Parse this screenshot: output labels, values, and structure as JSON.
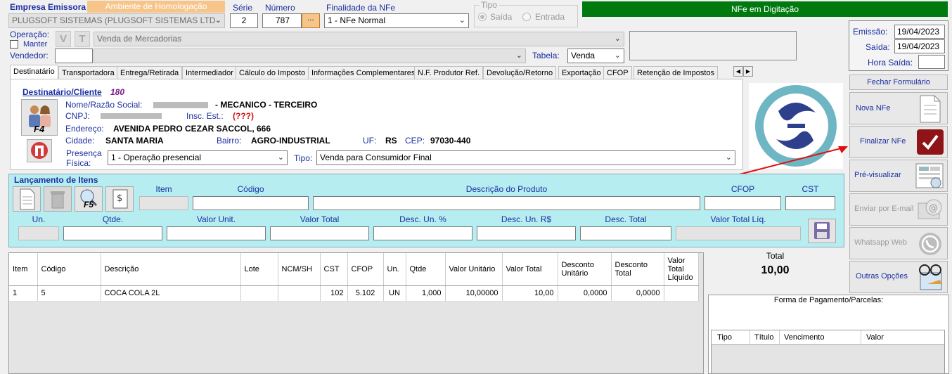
{
  "header": {
    "empresa_label": "Empresa Emissora",
    "empresa_value": "PLUGSOFT SISTEMAS  (PLUGSOFT SISTEMAS LTD",
    "ambiente": "Ambiente de Homologação",
    "serie_label": "Série",
    "serie_value": "2",
    "numero_label": "Número",
    "numero_value": "787",
    "numero_btn": "...",
    "finalidade_label": "Finalidade da NFe",
    "finalidade_value": "1 - NFe Normal",
    "tipo_label": "Tipo",
    "tipo_saida": "Saída",
    "tipo_entrada": "Entrada",
    "status": "NFe em Digitação",
    "operacao_label": "Operação:",
    "manter_label": "Manter",
    "v_btn": "V",
    "t_btn": "T",
    "operacao_value": "Venda de Mercadorias",
    "vendedor_label": "Vendedor:",
    "vendedor_code": "",
    "vendedor_value": "",
    "tabela_label": "Tabela:",
    "tabela_value": "Venda"
  },
  "dates": {
    "emissao_label": "Emissão:",
    "emissao_value": "19/04/2023",
    "saida_label": "Saída:",
    "saida_value": "19/04/2023",
    "hora_label": "Hora Saída:",
    "hora_value": ""
  },
  "tabs": [
    "Destinatário",
    "Transportadora",
    "Entrega/Retirada",
    "Intermediador",
    "Cálculo do Imposto",
    "Informações Complementares",
    "N.F. Produtor Ref.",
    "Devolução/Retorno",
    "Exportação",
    "CFOP",
    "Retenção de Impostos"
  ],
  "dest": {
    "title": "Destinatário/Cliente",
    "code": "180",
    "nome_label": "Nome/Razão Social:",
    "nome_value": "- MECANICO - TERCEIRO",
    "cnpj_label": "CNPJ:",
    "ie_label": "Insc. Est.:",
    "ie_value": "(???)",
    "endereco_label": "Endereço:",
    "endereco_value": "AVENIDA PEDRO CEZAR SACCOL, 666",
    "cidade_label": "Cidade:",
    "cidade_value": "SANTA MARIA",
    "bairro_label": "Bairro:",
    "bairro_value": "AGRO-INDUSTRIAL",
    "uf_label": "UF:",
    "uf_value": "RS",
    "cep_label": "CEP:",
    "cep_value": "97030-440",
    "presenca_label1": "Presença",
    "presenca_label2": "Física:",
    "presenca_value": "1 - Operação presencial",
    "tipo_label": "Tipo:",
    "tipo_value": "Venda para Consumidor Final",
    "f4": "F4"
  },
  "lancamento": {
    "title": "Lançamento de Itens",
    "f5": "F5",
    "item": "Item",
    "codigo": "Código",
    "descricao": "Descrição do Produto",
    "cfop": "CFOP",
    "cst": "CST",
    "un": "Un.",
    "qtde": "Qtde.",
    "valor_unit": "Valor Unit.",
    "valor_total": "Valor Total",
    "desc_un_pct": "Desc. Un. %",
    "desc_un_rs": "Desc. Un. R$",
    "desc_total": "Desc. Total",
    "valor_total_liq": "Valor Total Líq."
  },
  "sidebar": {
    "fechar": "Fechar Formulário",
    "nova": "Nova NFe",
    "finalizar": "Finalizar NFe",
    "previsualizar": "Pré-visualizar",
    "email": "Enviar por E-mail",
    "whatsapp": "Whatsapp Web",
    "outras": "Outras Opções"
  },
  "grid": {
    "headers": [
      "Item",
      "Código",
      "Descrição",
      "Lote",
      "NCM/SH",
      "CST",
      "CFOP",
      "Un.",
      "Qtde",
      "Valor Unitário",
      "Valor Total",
      "Desconto Unitário",
      "Desconto Total",
      "Valor Total Líquido"
    ],
    "rows": [
      [
        "1",
        "5",
        "COCA COLA 2L",
        "",
        "",
        "102",
        "5.102",
        "UN",
        "1,000",
        "10,00000",
        "10,00",
        "0,0000",
        "0,0000",
        ""
      ]
    ]
  },
  "total": {
    "label": "Total",
    "value": "10,00"
  },
  "pagamento": {
    "title": "Forma de Pagamento/Parcelas:",
    "headers": [
      "Tipo",
      "Título",
      "Vencimento",
      "Valor"
    ]
  },
  "colors": {
    "status_bg": "#007a0f",
    "ambiente_bg": "#f7c58a",
    "lancamento_bg": "#b6edf0",
    "label_blue": "#1b2fa0",
    "code_purple": "#7a1a8c"
  }
}
